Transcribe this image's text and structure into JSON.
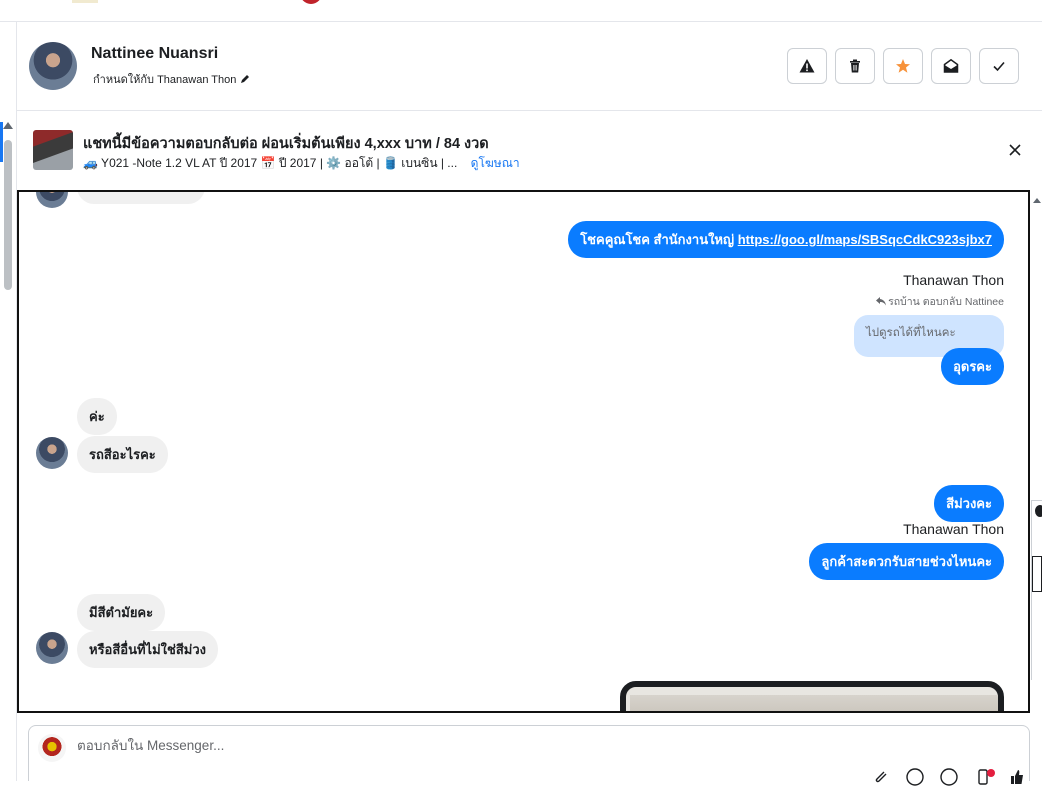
{
  "header": {
    "contact_name": "Nattinee Nuansri",
    "assigned_label": "กำหนดให้กับ Thanawan Thon",
    "actions": [
      {
        "name": "spam-button",
        "icon": "warning-icon"
      },
      {
        "name": "delete-button",
        "icon": "trash-icon"
      },
      {
        "name": "star-button",
        "icon": "star-icon",
        "color": "#f7923a"
      },
      {
        "name": "mark-unread-button",
        "icon": "envelope-open-icon"
      },
      {
        "name": "done-button",
        "icon": "check-icon"
      }
    ]
  },
  "ad": {
    "title": "แชทนี้มีข้อความตอบกลับต่อ ผ่อนเริ่มต้นเพียง 4,xxx บาท / 84 งวด",
    "subtitle": "🚙 Y021 -Note 1.2 VL AT ปี 2017 📅 ปี 2017 | ⚙️ ออโต้ | 🛢️ เบนซิน | ...",
    "link": "ดูโฆษณา"
  },
  "messages": {
    "m1": "โชคคูณโชค สำนักงานใหญ่",
    "m1_link": "https://goo.gl/maps/SBSqcCdkC923sjbx7",
    "sender1": "Thanawan Thon",
    "reply_meta": "รถบ้าน ตอบกลับ Nattinee",
    "quoted": "ไปดูรถได้ที่ไหนคะ",
    "m2": "อุดรคะ",
    "m3": "ค่ะ",
    "m4": "รถสีอะไรคะ",
    "m5": "สีม่วงคะ",
    "sender2": "Thanawan Thon",
    "m6": "ลูกค้าสะดวกรับสายช่วงไหนคะ",
    "m7": "มีสีตำมัยคะ",
    "m8": "หรือสีอื่นที่ไม่ใช่สีม่วง"
  },
  "composer": {
    "placeholder": "ตอบกลับใน Messenger..."
  },
  "colors": {
    "outgoing_bubble": "#0a7cff",
    "incoming_bubble": "#f0f0f0",
    "quoted_bubble": "#cfe4ff",
    "link": "#1877f2"
  }
}
